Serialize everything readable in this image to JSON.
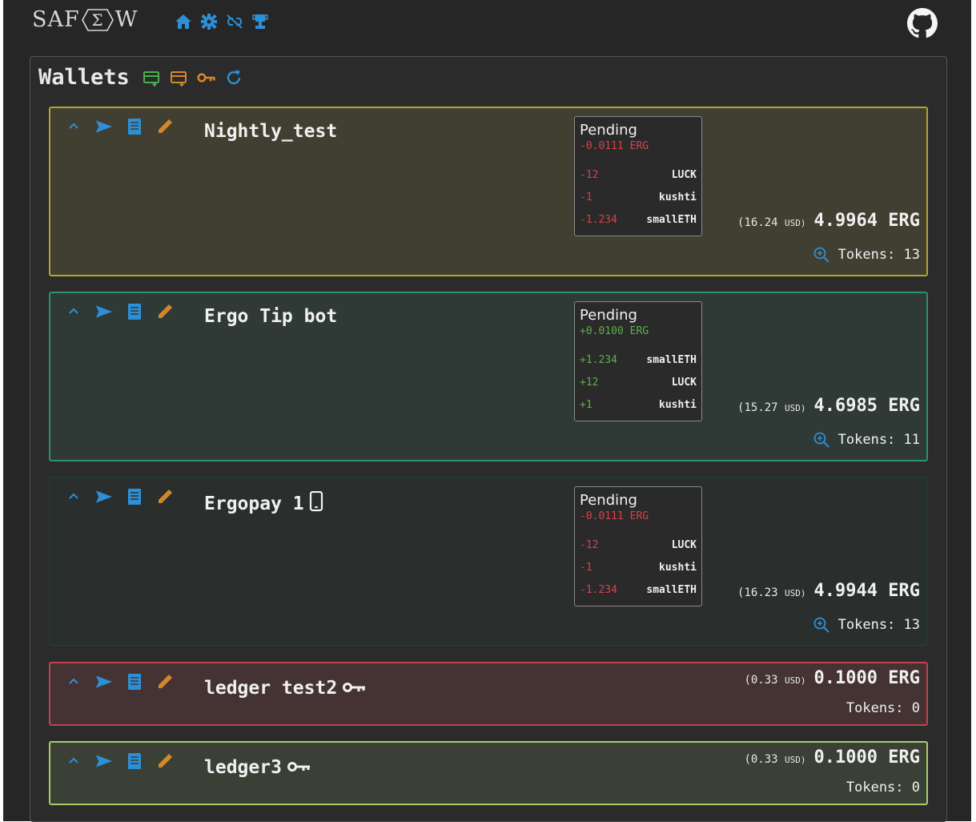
{
  "nav": {
    "logo_left": "SAF",
    "logo_sigma": "Σ",
    "logo_right": "W"
  },
  "panel": {
    "title": "Wallets"
  },
  "wallets": [
    {
      "name": "Nightly_test",
      "pending_title": "Pending",
      "pending_erg": "-0.0111 ERG",
      "pending_tokens": [
        {
          "amount": "-12",
          "name": "LUCK"
        },
        {
          "amount": "-1",
          "name": "kushti"
        },
        {
          "amount": "-1.234",
          "name": "smallETH"
        }
      ],
      "usd": "(16.24",
      "usd_unit": "USD)",
      "balance": "4.9964 ERG",
      "tokens": "Tokens: 13"
    },
    {
      "name": "Ergo Tip bot",
      "pending_title": "Pending",
      "pending_erg": "+0.0100 ERG",
      "pending_tokens": [
        {
          "amount": "+1.234",
          "name": "smallETH"
        },
        {
          "amount": "+12",
          "name": "LUCK"
        },
        {
          "amount": "+1",
          "name": "kushti"
        }
      ],
      "usd": "(15.27",
      "usd_unit": "USD)",
      "balance": "4.6985 ERG",
      "tokens": "Tokens: 11"
    },
    {
      "name": "Ergopay 1",
      "pending_title": "Pending",
      "pending_erg": "-0.0111 ERG",
      "pending_tokens": [
        {
          "amount": "-12",
          "name": "LUCK"
        },
        {
          "amount": "-1",
          "name": "kushti"
        },
        {
          "amount": "-1.234",
          "name": "smallETH"
        }
      ],
      "usd": "(16.23",
      "usd_unit": "USD)",
      "balance": "4.9944 ERG",
      "tokens": "Tokens: 13"
    },
    {
      "name": "ledger test2",
      "usd": "(0.33",
      "usd_unit": "USD)",
      "balance": "0.1000 ERG",
      "tokens": "Tokens: 0"
    },
    {
      "name": "ledger3",
      "usd": "(0.33",
      "usd_unit": "USD)",
      "balance": "0.1000 ERG",
      "tokens": "Tokens: 0"
    }
  ],
  "colors": {
    "accent_blue": "#2d8fd5",
    "green": "#4caf50",
    "orange": "#d4872a",
    "negative": "#d9404a",
    "positive": "#5fae4e"
  }
}
